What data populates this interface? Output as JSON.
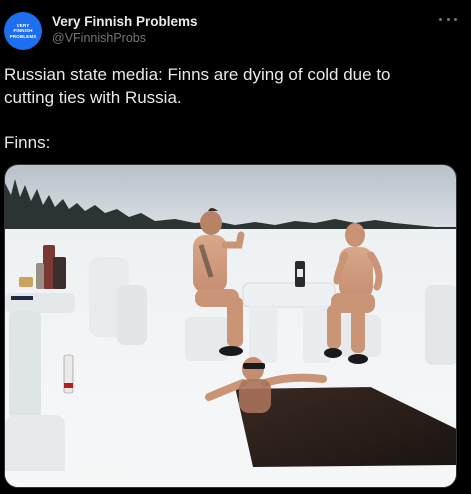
{
  "tweet": {
    "author": {
      "display_name": "Very Finnish Problems",
      "handle": "@VFinnishProbs",
      "avatar_text": [
        "VERY",
        "FINNISH",
        "PROBLEMS"
      ],
      "avatar_color": "#1d6ff0"
    },
    "more_icon": "more-horizontal-icon",
    "text_lines": [
      "Russian state media: Finns are dying of cold due to",
      "cutting ties with Russia.",
      "",
      "Finns:"
    ],
    "media": {
      "description_icon": "photo-image"
    }
  },
  "colors": {
    "background": "#000000",
    "text_primary": "#e7e9ea",
    "text_secondary": "#71767b"
  }
}
